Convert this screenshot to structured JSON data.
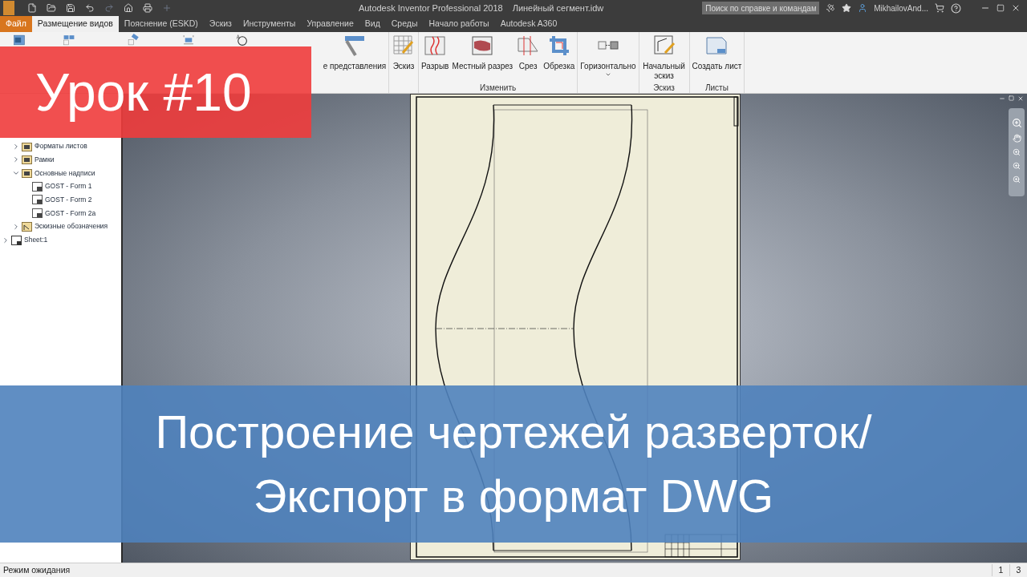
{
  "title_bar": {
    "app_title": "Autodesk Inventor Professional 2018",
    "document_title": "Линейный сегмент.idw",
    "search": {
      "placeholder": "Поиск по справке и командам"
    },
    "user": "MikhailovAnd..."
  },
  "menu_tabs": [
    {
      "label": "Файл",
      "kind": "file",
      "selected": false
    },
    {
      "label": "Размещение видов",
      "kind": "tab",
      "selected": true
    },
    {
      "label": "Пояснение (ESKD)",
      "kind": "tab",
      "selected": false
    },
    {
      "label": "Эскиз",
      "kind": "tab",
      "selected": false
    },
    {
      "label": "Инструменты",
      "kind": "tab",
      "selected": false
    },
    {
      "label": "Управление",
      "kind": "tab",
      "selected": false
    },
    {
      "label": "Вид",
      "kind": "tab",
      "selected": false
    },
    {
      "label": "Среды",
      "kind": "tab",
      "selected": false
    },
    {
      "label": "Начало работы",
      "kind": "tab",
      "selected": false
    },
    {
      "label": "Autodesk A360",
      "kind": "tab",
      "selected": false
    }
  ],
  "ribbon": {
    "groups": [
      {
        "buttons": [
          {
            "kind": "base"
          },
          {
            "kind": "projected"
          },
          {
            "kind": "auxiliary"
          },
          {
            "kind": "section"
          },
          {
            "kind": "detail"
          },
          {
            "label": "е представления",
            "kind": "overlay"
          }
        ]
      },
      {
        "buttons": [
          {
            "label": "Эскиз",
            "kind": "sketch"
          }
        ]
      },
      {
        "label": "Изменить",
        "buttons": [
          {
            "label": "Разрыв",
            "kind": "break"
          },
          {
            "label": "Местный разрез",
            "kind": "breakout"
          },
          {
            "label": "Срез",
            "kind": "slice"
          },
          {
            "label": "Обрезка",
            "kind": "crop"
          }
        ]
      },
      {
        "buttons": [
          {
            "label": "Горизонтально",
            "kind": "align",
            "dropdown": true
          }
        ]
      },
      {
        "label": "Эскиз",
        "buttons": [
          {
            "label": "Начальный эскиз",
            "kind": "startsketch"
          }
        ]
      },
      {
        "label": "Листы",
        "buttons": [
          {
            "label": "Создать лист",
            "kind": "sheet"
          }
        ]
      }
    ]
  },
  "browser": {
    "tree": [
      {
        "children": [
          {
            "children": [
              {
                "label": "Форматы листов",
                "kind": "folder",
                "expanded": false
              },
              {
                "label": "Рамки",
                "kind": "folder",
                "expanded": false
              },
              {
                "label": "Основные надписи",
                "kind": "folder",
                "expanded": true,
                "children": [
                  {
                    "label": "GOST - Form 1",
                    "kind": "titleblock"
                  },
                  {
                    "label": "GOST - Form 2",
                    "kind": "titleblock"
                  },
                  {
                    "label": "GOST - Form 2a",
                    "kind": "titleblock"
                  }
                ]
              },
              {
                "label": "Эскизные обозначения",
                "kind": "symbols",
                "expanded": false
              }
            ]
          },
          {
            "label": "Sheet:1",
            "kind": "sheet",
            "expanded": false
          }
        ]
      }
    ]
  },
  "overlays": {
    "lesson_badge": "Урок #10",
    "title_lines": [
      "Построение чертежей разверток/",
      "Экспорт в формат DWG"
    ]
  },
  "status_bar": {
    "message": "Режим ожидания",
    "fields": [
      "1",
      "3"
    ]
  }
}
